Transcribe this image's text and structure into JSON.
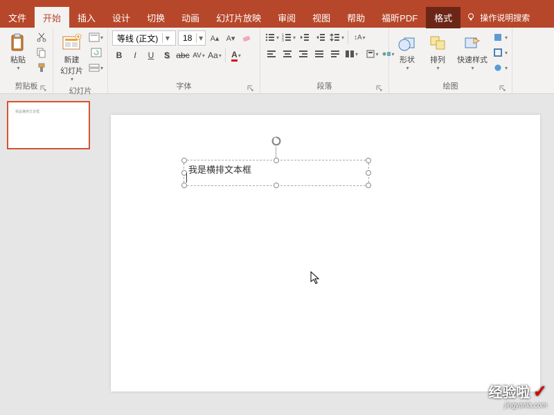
{
  "tabs": {
    "file": "文件",
    "home": "开始",
    "insert": "插入",
    "design": "设计",
    "transition": "切换",
    "animation": "动画",
    "slideshow": "幻灯片放映",
    "review": "审阅",
    "view": "视图",
    "help": "帮助",
    "foxit": "福昕PDF",
    "format": "格式",
    "tell": "操作说明搜索"
  },
  "clipboard": {
    "paste": "粘贴",
    "label": "剪贴板"
  },
  "slides": {
    "new": "新建\n幻灯片",
    "label": "幻灯片"
  },
  "font": {
    "name": "等线 (正文)",
    "size": "18",
    "label": "字体",
    "actions": {
      "bold": "B",
      "italic": "I",
      "underline": "U",
      "strike": "S",
      "shadow": "abc",
      "spacing": "AV",
      "case": "Aa"
    }
  },
  "paragraph": {
    "label": "段落"
  },
  "drawing": {
    "shapes": "形状",
    "arrange": "排列",
    "quickstyle": "快速样式",
    "label": "绘图"
  },
  "textbox": {
    "content": "我是横排文本框"
  },
  "watermark": {
    "brand": "经验啦",
    "url": "jingyanla.com"
  }
}
